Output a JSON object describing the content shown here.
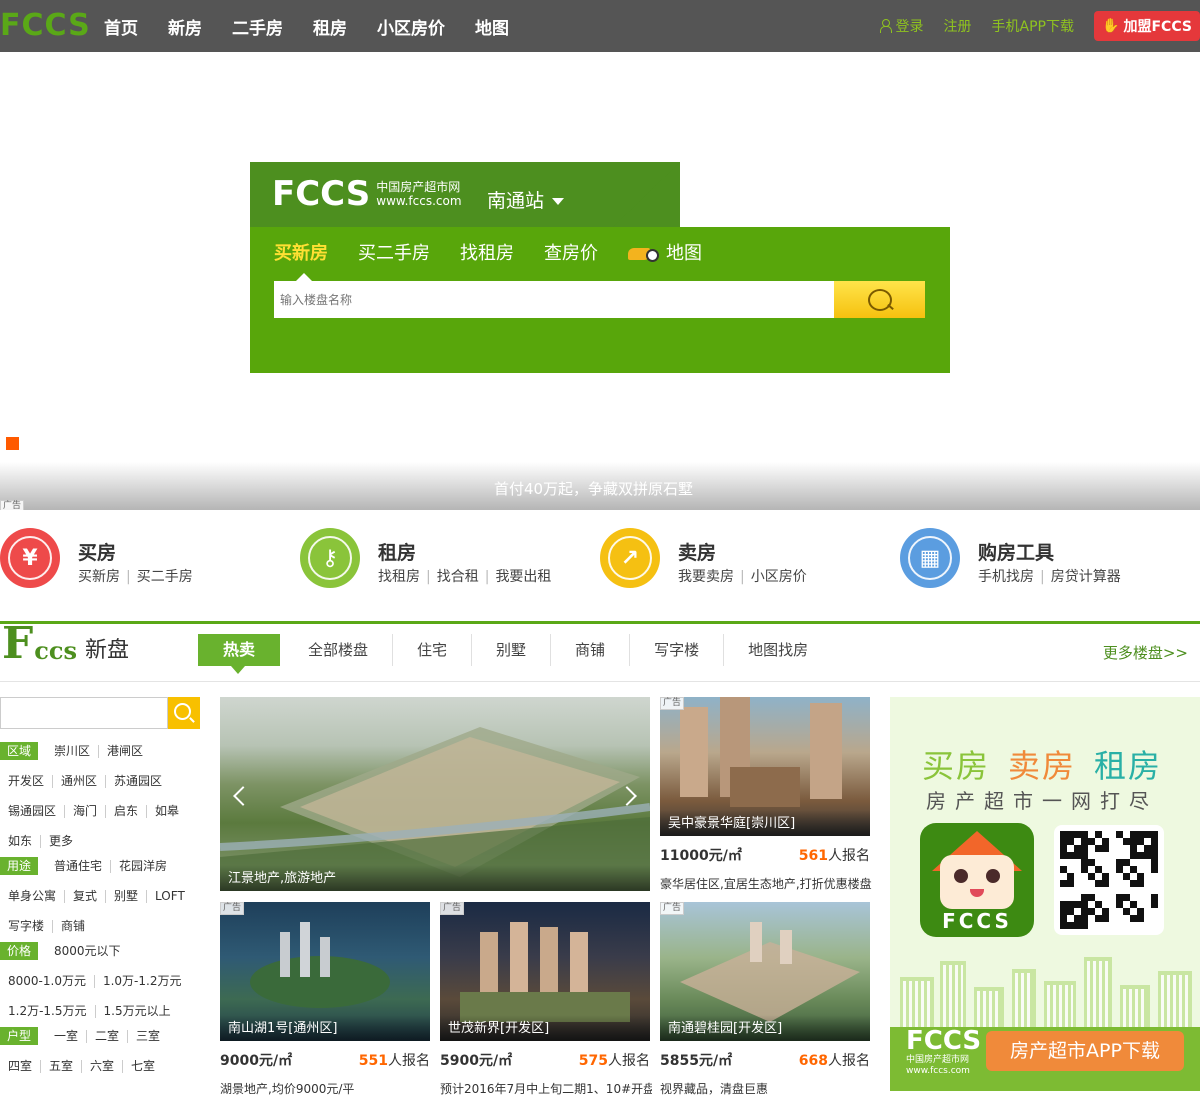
{
  "topbar": {
    "logo": "FCCS",
    "nav": [
      "首页",
      "新房",
      "二手房",
      "租房",
      "小区房价",
      "地图"
    ],
    "login": "登录",
    "register": "注册",
    "app_download": "手机APP下载",
    "join": "加盟FCCS"
  },
  "search": {
    "logo_big": "FCCS",
    "logo_cn": "中国房产超市网",
    "logo_url": "www.fccs.com",
    "city": "南通站",
    "tabs": [
      "买新房",
      "买二手房",
      "找租房",
      "查房价",
      "地图"
    ],
    "placeholder": "输入楼盘名称"
  },
  "hero": {
    "caption": "首付40万起，争藏双拼原石墅",
    "ad": "广告"
  },
  "services": [
    {
      "title": "买房",
      "links": [
        "买新房",
        "买二手房"
      ],
      "icon": "yen-house-icon",
      "color": "#ee4a4a"
    },
    {
      "title": "租房",
      "links": [
        "找租房",
        "找合租",
        "我要出租"
      ],
      "icon": "key-house-icon",
      "color": "#8ac43a"
    },
    {
      "title": "卖房",
      "links": [
        "我要卖房",
        "小区房价"
      ],
      "icon": "sell-house-icon",
      "color": "#f5c012"
    },
    {
      "title": "购房工具",
      "links": [
        "手机找房",
        "房贷计算器"
      ],
      "icon": "calculator-icon",
      "color": "#5b9de0"
    }
  ],
  "newhouse": {
    "logo_F": "F",
    "logo_ccs": "ccs",
    "logo_title": "新盘",
    "tabs": [
      "热卖",
      "全部楼盘",
      "住宅",
      "别墅",
      "商铺",
      "写字楼",
      "地图找房"
    ],
    "more": "更多楼盘>>"
  },
  "filter": {
    "rows": [
      {
        "label": "区域",
        "items": [
          "崇川区",
          "港闸区"
        ]
      },
      {
        "label": "",
        "items": [
          "开发区",
          "通州区",
          "苏通园区"
        ]
      },
      {
        "label": "",
        "items": [
          "锡通园区",
          "海门",
          "启东",
          "如皋"
        ]
      },
      {
        "label": "",
        "items": [
          "如东",
          "更多"
        ]
      },
      {
        "label": "用途",
        "items": [
          "普通住宅",
          "花园洋房"
        ]
      },
      {
        "label": "",
        "items": [
          "单身公寓",
          "复式",
          "别墅",
          "LOFT"
        ]
      },
      {
        "label": "",
        "items": [
          "写字楼",
          "商铺"
        ]
      },
      {
        "label": "价格",
        "items": [
          "8000元以下"
        ]
      },
      {
        "label": "",
        "items": [
          "8000-1.0万元",
          "1.0万-1.2万元"
        ]
      },
      {
        "label": "",
        "items": [
          "1.2万-1.5万元",
          "1.5万元以上"
        ]
      },
      {
        "label": "户型",
        "items": [
          "一室",
          "二室",
          "三室"
        ]
      },
      {
        "label": "",
        "items": [
          "四室",
          "五室",
          "六室",
          "七室"
        ]
      }
    ]
  },
  "listings": {
    "featured": {
      "caption": "江景地产,旅游地产"
    },
    "cards": [
      {
        "name": "吴中豪景华庭[崇川区]",
        "price": "11000元/㎡",
        "count": "561",
        "suffix": "人报名",
        "desc": "豪华居住区,宜居生态地产,打折优惠楼盘",
        "ad": "广告"
      },
      {
        "name": "南山湖1号[通州区]",
        "price": "9000元/㎡",
        "count": "551",
        "suffix": "人报名",
        "desc": "湖景地产,均价9000元/平",
        "ad": "广告"
      },
      {
        "name": "世茂新界[开发区]",
        "price": "5900元/㎡",
        "count": "575",
        "suffix": "人报名",
        "desc": "预计2016年7月中上旬二期1、10#开盘",
        "ad": "广告"
      },
      {
        "name": "南通碧桂园[开发区]",
        "price": "5855元/㎡",
        "count": "668",
        "suffix": "人报名",
        "desc": "视界藏品，清盘巨惠",
        "ad": "广告"
      }
    ]
  },
  "appad": {
    "t1": "买房",
    "t2": "卖房",
    "t3": "租房",
    "sub": "房产超市一网打尽",
    "icon_text": "FCCS",
    "logo_big": "FCCS",
    "logo_small": "中国房产超市网",
    "logo_url": "www.fccs.com",
    "button": "房产超市APP下载"
  }
}
